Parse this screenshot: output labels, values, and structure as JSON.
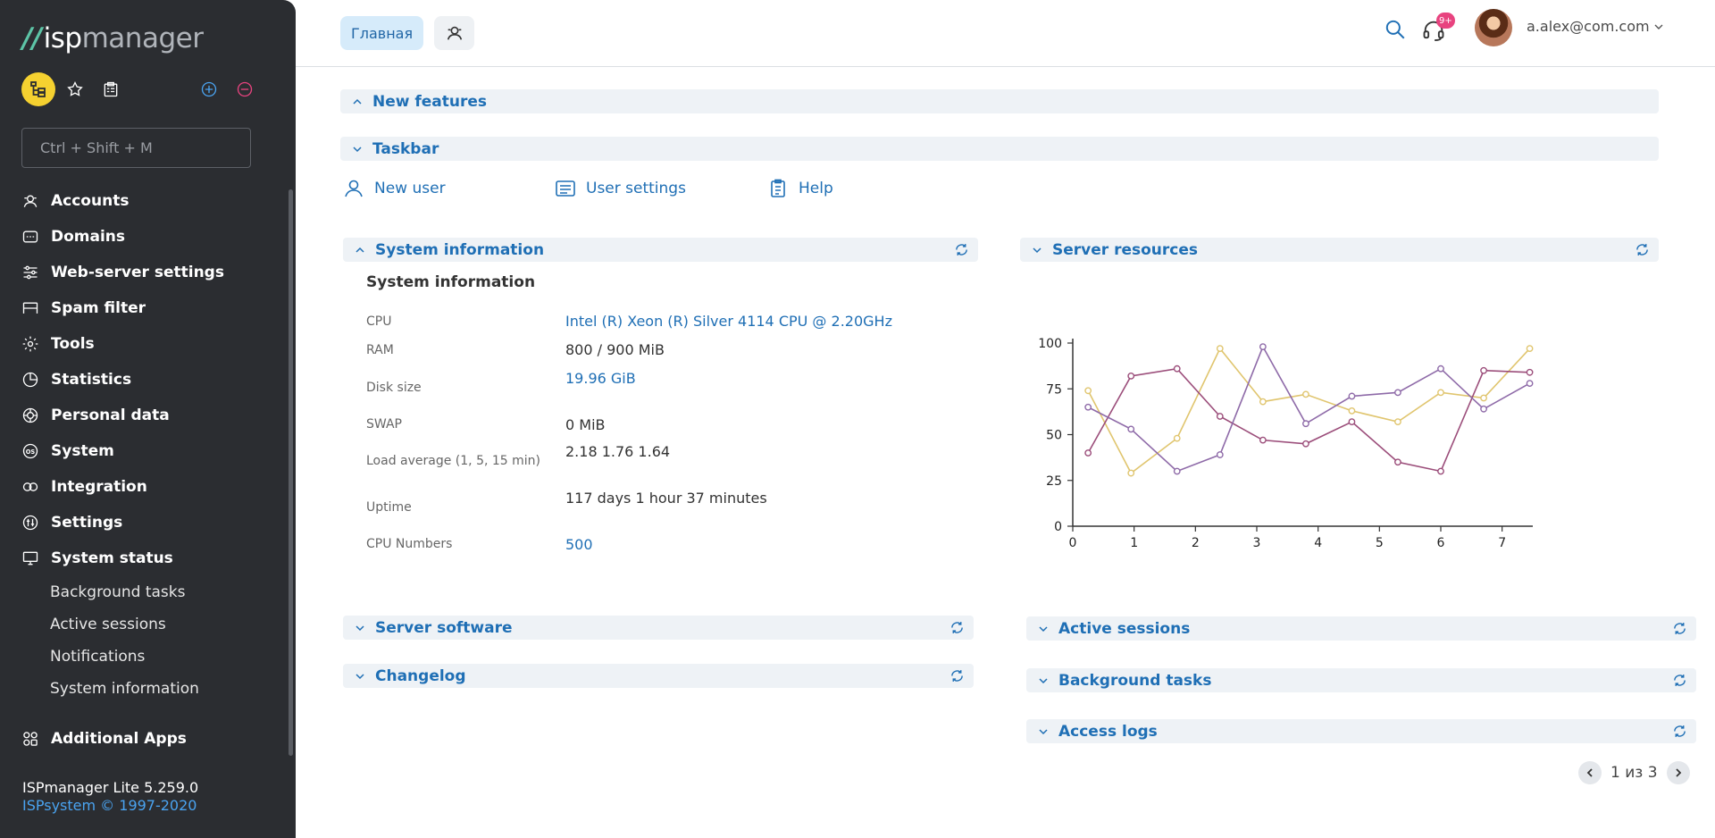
{
  "sidebar": {
    "logo": {
      "mark": "//",
      "isp": "isp",
      "manager": "manager"
    },
    "search_placeholder": "Ctrl + Shift + M",
    "menu": [
      {
        "label": "Accounts",
        "icon": "accounts-icon"
      },
      {
        "label": "Domains",
        "icon": "domains-icon"
      },
      {
        "label": "Web-server settings",
        "icon": "sliders-icon"
      },
      {
        "label": "Spam filter",
        "icon": "filter-icon"
      },
      {
        "label": "Tools",
        "icon": "gear-icon"
      },
      {
        "label": "Statistics",
        "icon": "pie-icon"
      },
      {
        "label": "Personal data",
        "icon": "personal-data-icon"
      },
      {
        "label": "System",
        "icon": "os-icon"
      },
      {
        "label": "Integration",
        "icon": "integration-icon"
      },
      {
        "label": "Settings",
        "icon": "settings-icon"
      },
      {
        "label": "System status",
        "icon": "monitor-icon"
      }
    ],
    "submenu": [
      "Background tasks",
      "Active sessions",
      "Notifications",
      "System information"
    ],
    "apps_label": "Additional Apps",
    "footer": {
      "version": "ISPmanager Lite 5.259.0",
      "copyright": "ISPsystem © 1997-2020"
    }
  },
  "header": {
    "home_tab": "Главная",
    "badge": "9+",
    "user": "a.alex@com.com"
  },
  "sections": {
    "new_features": "New features",
    "taskbar": "Taskbar",
    "system_information": "System information",
    "server_resources": "Server resources",
    "server_software": "Server software",
    "changelog": "Changelog",
    "active_sessions": "Active sessions",
    "background_tasks": "Background tasks",
    "access_logs": "Access logs"
  },
  "taskbar": {
    "new_user": "New user",
    "user_settings": "User settings",
    "help": "Help"
  },
  "system_info": {
    "title": "System information",
    "rows": [
      {
        "label": "CPU",
        "value": "Intel (R) Xeon (R) Silver 4114 CPU @ 2.20GHz"
      },
      {
        "label": "RAM",
        "value": "800 / 900 MiB"
      },
      {
        "label": "Disk size",
        "value": "19.96 GiB"
      },
      {
        "label": "SWAP",
        "value": "0 MiB"
      },
      {
        "label": "Load average (1, 5, 15 min)",
        "value": "2.18 1.76 1.64"
      },
      {
        "label": "Uptime",
        "value": "117 days 1 hour 37 minutes"
      },
      {
        "label": "CPU Numbers",
        "value": "500"
      }
    ]
  },
  "pager": {
    "text": "1 из 3"
  },
  "colors": {
    "accent": "#1f6fb5",
    "sidebar_bg": "#2b2d31",
    "yellow": "#f5d130",
    "series_gold": "#e0c56e",
    "series_plum": "#9b4d7a",
    "series_violet": "#8e6aa8"
  },
  "chart_data": {
    "type": "line",
    "x_ticks": [
      0,
      1,
      2,
      3,
      4,
      5,
      6,
      7
    ],
    "y_ticks": [
      0,
      25,
      50,
      75,
      100
    ],
    "xlim": [
      0,
      7.5
    ],
    "ylim": [
      0,
      100
    ],
    "grid": false,
    "series": [
      {
        "color": "#e0c56e",
        "x": [
          0.25,
          0.95,
          1.7,
          2.4,
          3.1,
          3.8,
          4.55,
          5.3,
          6.0,
          6.7,
          7.45
        ],
        "y": [
          74,
          29,
          48,
          97,
          68,
          72,
          63,
          57,
          73,
          70,
          97
        ]
      },
      {
        "color": "#9b4d7a",
        "x": [
          0.25,
          0.95,
          1.7,
          2.4,
          3.1,
          3.8,
          4.55,
          5.3,
          6.0,
          6.7,
          7.45
        ],
        "y": [
          40,
          82,
          86,
          60,
          47,
          45,
          57,
          35,
          30,
          85,
          84
        ]
      },
      {
        "color": "#8e6aa8",
        "x": [
          0.25,
          0.95,
          1.7,
          2.4,
          3.1,
          3.8,
          4.55,
          5.3,
          6.0,
          6.7,
          7.45
        ],
        "y": [
          65,
          53,
          30,
          39,
          98,
          56,
          71,
          73,
          86,
          64,
          78
        ]
      }
    ]
  }
}
